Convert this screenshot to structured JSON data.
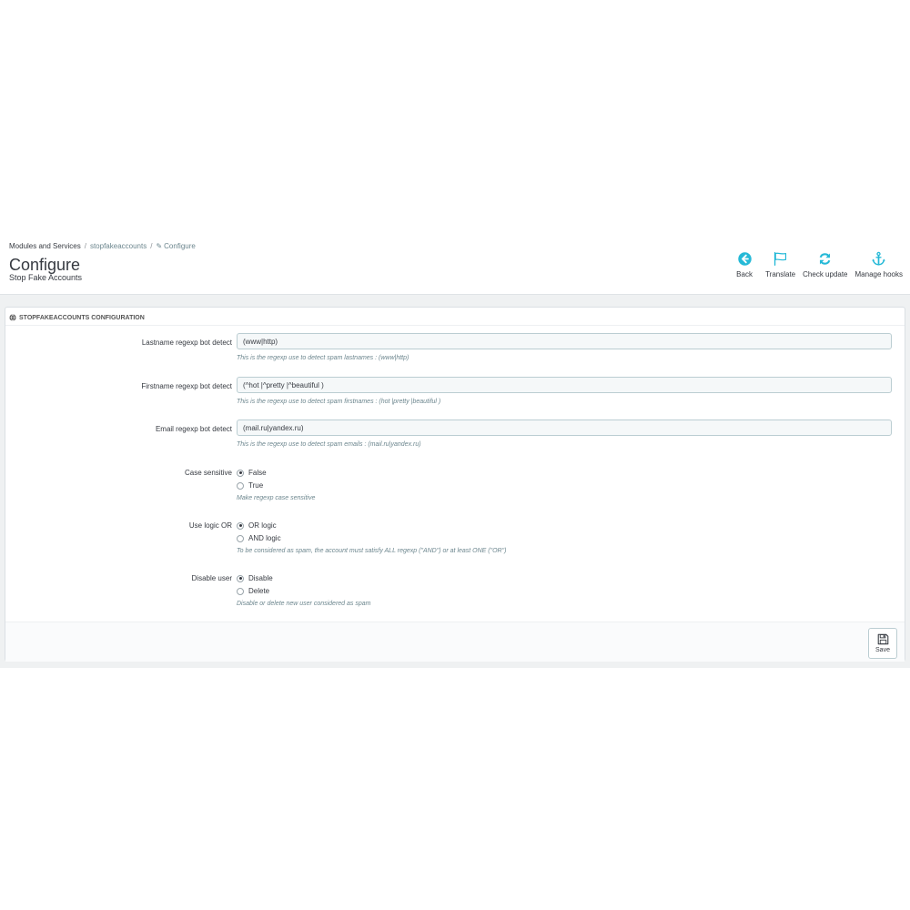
{
  "breadcrumb": {
    "level1": "Modules and Services",
    "level2": "stopfakeaccounts",
    "level3": "Configure"
  },
  "header": {
    "title": "Configure",
    "subtitle": "Stop Fake Accounts"
  },
  "toolbar": {
    "back": "Back",
    "translate": "Translate",
    "check_update": "Check update",
    "manage_hooks": "Manage hooks",
    "icon_color": "#25b9d7"
  },
  "panel": {
    "heading": "STOPFAKEACCOUNTS CONFIGURATION",
    "lastname": {
      "label": "Lastname regexp bot detect",
      "value": "(www|http)",
      "help": "This is the regexp use to detect spam lastnames : (www|http)"
    },
    "firstname": {
      "label": "Firstname regexp bot detect",
      "value": "(^hot |^pretty |^beautiful )",
      "help": "This is the regexp use to detect spam firstnames : (hot |pretty |beautiful )"
    },
    "email": {
      "label": "Email regexp bot detect",
      "value": "(mail.ru|yandex.ru)",
      "help": "This is the regexp use to detect spam emails : (mail.ru|yandex.ru)"
    },
    "case_sensitive": {
      "label": "Case sensitive",
      "options": [
        "False",
        "True"
      ],
      "selected": "False",
      "help": "Make regexp case sensitive"
    },
    "logic": {
      "label": "Use logic OR",
      "options": [
        "OR logic",
        "AND logic"
      ],
      "selected": "OR logic",
      "help": "To be considered as spam, the account must satisfy ALL regexp (\"AND\") or at least ONE (\"OR\")"
    },
    "disable_user": {
      "label": "Disable user",
      "options": [
        "Disable",
        "Delete"
      ],
      "selected": "Disable",
      "help": "Disable or delete new user considered as spam"
    },
    "save_label": "Save"
  }
}
